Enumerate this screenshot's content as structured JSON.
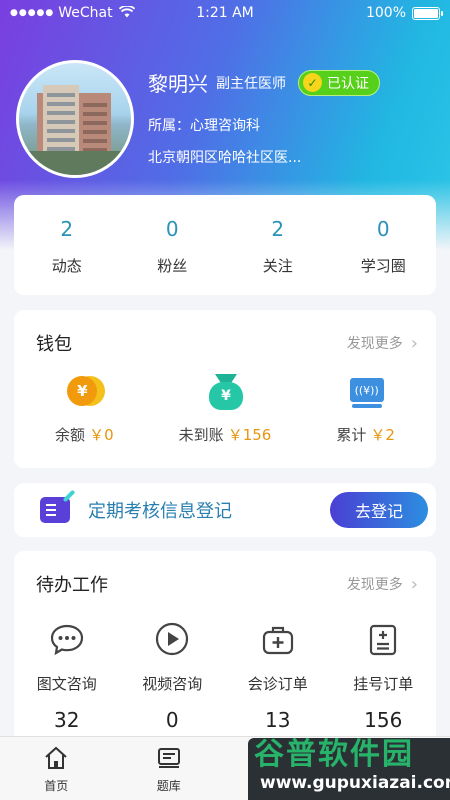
{
  "status_bar": {
    "carrier": "WeChat",
    "time": "1:21 AM",
    "battery": "100%"
  },
  "profile": {
    "name": "黎明兴",
    "title": "副主任医师",
    "verified_badge": "已认证",
    "department": "所属：心理咨询科",
    "address": "北京朝阳区哈哈社区医..."
  },
  "stats": [
    {
      "value": "2",
      "label": "动态"
    },
    {
      "value": "0",
      "label": "粉丝"
    },
    {
      "value": "2",
      "label": "关注"
    },
    {
      "value": "0",
      "label": "学习圈"
    }
  ],
  "wallet": {
    "title": "钱包",
    "more": "发现更多",
    "items": [
      {
        "label": "余额",
        "amount": "￥0",
        "icon": "coins-icon"
      },
      {
        "label": "未到账",
        "amount": "￥156",
        "icon": "money-bag-icon"
      },
      {
        "label": "累计",
        "amount": "￥2",
        "icon": "cash-machine-icon"
      }
    ]
  },
  "register": {
    "text": "定期考核信息登记",
    "button": "去登记"
  },
  "todo": {
    "title": "待办工作",
    "more": "发现更多",
    "items": [
      {
        "label": "图文咨询",
        "count": "32",
        "icon": "chat-bubble-icon"
      },
      {
        "label": "视频咨询",
        "count": "0",
        "icon": "play-circle-icon"
      },
      {
        "label": "会诊订单",
        "count": "13",
        "icon": "medical-kit-icon"
      },
      {
        "label": "挂号订单",
        "count": "156",
        "icon": "clipboard-plus-icon"
      }
    ]
  },
  "tabbar": [
    {
      "label": "首页",
      "icon": "home-icon"
    },
    {
      "label": "题库",
      "icon": "question-bank-icon"
    }
  ],
  "watermark": {
    "top": "谷普软件园",
    "bottom": "www.gupuxiazai.com"
  },
  "colors": {
    "accent": "#2a93b8",
    "amount": "#e8960f",
    "verified": "#56d01a"
  }
}
